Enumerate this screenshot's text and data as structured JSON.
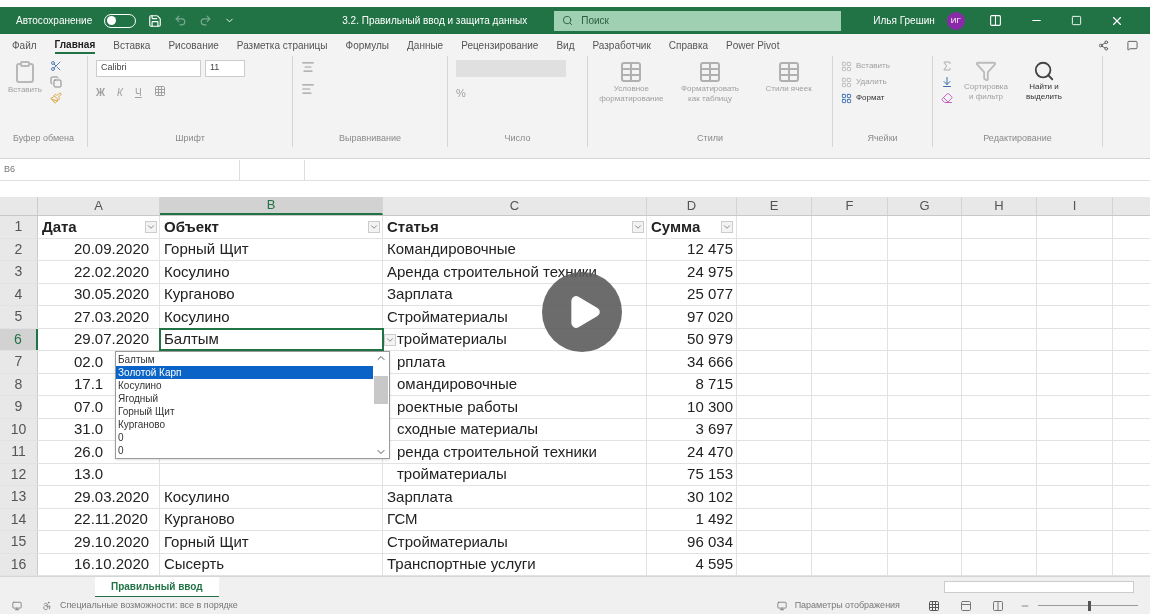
{
  "title_bar": {
    "autosave_label": "Автосохранение",
    "autosave_on": false,
    "document_title": "3.2. Правильный ввод и защита данных",
    "search_placeholder": "Поиск",
    "user_name": "Илья Грешин",
    "user_initials": "ИГ"
  },
  "ribbon_tabs": [
    {
      "label": "Файл",
      "selected": false
    },
    {
      "label": "Главная",
      "selected": true
    },
    {
      "label": "Вставка",
      "selected": false
    },
    {
      "label": "Рисование",
      "selected": false
    },
    {
      "label": "Разметка страницы",
      "selected": false
    },
    {
      "label": "Формулы",
      "selected": false
    },
    {
      "label": "Данные",
      "selected": false
    },
    {
      "label": "Рецензирование",
      "selected": false
    },
    {
      "label": "Вид",
      "selected": false
    },
    {
      "label": "Разработчик",
      "selected": false
    },
    {
      "label": "Справка",
      "selected": false
    },
    {
      "label": "Power Pivot",
      "selected": false
    }
  ],
  "ribbon": {
    "clipboard": {
      "paste": "Вставить",
      "group": "Буфер обмена"
    },
    "font": {
      "name": "Calibri",
      "size": "11",
      "bold": "Ж",
      "italic": "К",
      "underline": "Ч",
      "group": "Шрифт"
    },
    "alignment": {
      "group": "Выравнивание"
    },
    "number": {
      "percent": "%",
      "group": "Число"
    },
    "styles": {
      "items": [
        "Условное форматирование",
        "Форматировать как таблицу",
        "Стили ячеек"
      ],
      "group": "Стили"
    },
    "cells": {
      "items": [
        "Вставить",
        "Удалить",
        "Формат"
      ],
      "group": "Ячейки"
    },
    "editing": {
      "items": [
        "Сортировка и фильтр",
        "Найти и выделить"
      ],
      "group": "Редактирование"
    }
  },
  "formula_bar": {
    "name_box": "B6"
  },
  "sheet": {
    "columns": [
      {
        "label": "A",
        "selected": false
      },
      {
        "label": "B",
        "selected": true
      },
      {
        "label": "C",
        "selected": false
      },
      {
        "label": "D",
        "selected": false
      },
      {
        "label": "E",
        "selected": false
      },
      {
        "label": "F",
        "selected": false
      },
      {
        "label": "G",
        "selected": false
      },
      {
        "label": "H",
        "selected": false
      },
      {
        "label": "I",
        "selected": false
      }
    ],
    "header": {
      "number": "1",
      "date": "Дата",
      "object": "Объект",
      "article": "Статья",
      "sum": "Сумма"
    },
    "rows": [
      {
        "number": "2",
        "selected": false,
        "date": "20.09.2020",
        "object": "Горный Щит",
        "article": "Командировочные",
        "sum": "12 475"
      },
      {
        "number": "3",
        "selected": false,
        "date": "22.02.2020",
        "object": "Косулино",
        "article": "Аренда строительной техники",
        "sum": "24 975"
      },
      {
        "number": "4",
        "selected": false,
        "date": "30.05.2020",
        "object": "Курганово",
        "article": "Зарплата",
        "sum": "25 077"
      },
      {
        "number": "5",
        "selected": false,
        "date": "27.03.2020",
        "object": "Косулино",
        "article": "Стройматериалы",
        "sum": "97 020"
      },
      {
        "number": "6",
        "selected": true,
        "date": "29.07.2020",
        "object": "Балтым",
        "article": "тройматериалы",
        "sum": "50 979"
      },
      {
        "number": "7",
        "selected": false,
        "date": "02.0",
        "article": "рплата",
        "sum": "34 666"
      },
      {
        "number": "8",
        "selected": false,
        "date": "17.1",
        "article": "омандировочные",
        "sum": "8 715"
      },
      {
        "number": "9",
        "selected": false,
        "date": "07.0",
        "article": "роектные работы",
        "sum": "10 300"
      },
      {
        "number": "10",
        "selected": false,
        "date": "31.0",
        "article": "сходные материалы",
        "sum": "3 697"
      },
      {
        "number": "11",
        "selected": false,
        "date": "26.0",
        "article": "ренда строительной техники",
        "sum": "24 470"
      },
      {
        "number": "12",
        "selected": false,
        "date": "13.0",
        "article": "тройматериалы",
        "sum": "75 153"
      },
      {
        "number": "13",
        "selected": false,
        "date": "29.03.2020",
        "object": "Косулино",
        "article": "Зарплата",
        "sum": "30 102"
      },
      {
        "number": "14",
        "selected": false,
        "date": "22.11.2020",
        "object": "Курганово",
        "article": "ГСМ",
        "sum": "1 492"
      },
      {
        "number": "15",
        "selected": false,
        "date": "29.10.2020",
        "object": "Горный Щит",
        "article": "Стройматериалы",
        "sum": "96 034"
      },
      {
        "number": "16",
        "selected": false,
        "date": "16.10.2020",
        "object": "Сысерть",
        "article": "Транспортные услуги",
        "sum": "4 595"
      }
    ]
  },
  "dropdown": {
    "items": [
      {
        "label": "Балтым",
        "selected": false
      },
      {
        "label": "Золотой Карп",
        "selected": true
      },
      {
        "label": "Косулино",
        "selected": false
      },
      {
        "label": "Ягодный",
        "selected": false
      },
      {
        "label": "Горный Щит",
        "selected": false
      },
      {
        "label": "Курганово",
        "selected": false
      },
      {
        "label": "0",
        "selected": false
      },
      {
        "label": "0",
        "selected": false
      }
    ]
  },
  "sheet_tabs": [
    {
      "label": "Правильный ввод",
      "selected": true
    }
  ],
  "status_bar": {
    "accessibility": "Специальные возможности: все в порядке",
    "display_settings": "Параметры отображения",
    "zoom": {
      "level": 0.5
    }
  }
}
